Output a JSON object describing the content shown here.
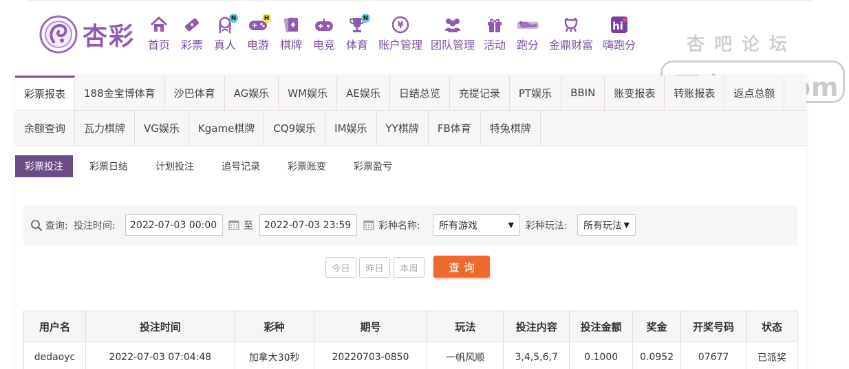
{
  "brand": {
    "name": "杏彩"
  },
  "nav": [
    {
      "label": "首页",
      "icon": "home-icon"
    },
    {
      "label": "彩票",
      "icon": "lottery-ticket-icon"
    },
    {
      "label": "真人",
      "icon": "live-dealer-icon",
      "badge": "N"
    },
    {
      "label": "电游",
      "icon": "gamepad-icon",
      "badge": "H"
    },
    {
      "label": "棋牌",
      "icon": "cards-icon"
    },
    {
      "label": "电竞",
      "icon": "esports-controller-icon"
    },
    {
      "label": "体育",
      "icon": "trophy-icon",
      "badge": "N"
    },
    {
      "label": "账户管理",
      "icon": "yen-coin-icon"
    },
    {
      "label": "团队管理",
      "icon": "team-icon"
    },
    {
      "label": "活动",
      "icon": "gift-icon"
    },
    {
      "label": "跑分",
      "icon": "running-icon"
    },
    {
      "label": "金鼎财富",
      "icon": "ding-icon"
    },
    {
      "label": "嗨跑分",
      "icon": "hi-app-icon"
    }
  ],
  "watermark": {
    "top": "杏吧论坛",
    "main": "回家14.com"
  },
  "tabs_row1": [
    "彩票报表",
    "188金宝博体育",
    "沙巴体育",
    "AG娱乐",
    "WM娱乐",
    "AE娱乐",
    "日结总览",
    "充提记录",
    "PT娱乐",
    "BBIN",
    "账变报表",
    "转账报表",
    "返点总额"
  ],
  "tabs_row2": [
    "余额查询",
    "瓦力棋牌",
    "VG娱乐",
    "Kgame棋牌",
    "CQ9娱乐",
    "IM娱乐",
    "YY棋牌",
    "FB体育",
    "特兔棋牌"
  ],
  "subtabs": [
    "彩票投注",
    "彩票日结",
    "计划投注",
    "追号记录",
    "彩票账变",
    "彩票盈亏"
  ],
  "query": {
    "label": "查询:",
    "time_label": "投注时间:",
    "start": "2022-07-03 00:00:00",
    "to": "至",
    "end": "2022-07-03 23:59:59",
    "game_label": "彩种名称:",
    "game_value": "所有游戏",
    "play_label": "彩种玩法:",
    "play_value": "所有玩法",
    "today": "今日",
    "yesterday": "昨日",
    "week": "本周",
    "search": "查询"
  },
  "table": {
    "headers": [
      "用户名",
      "投注时间",
      "彩种",
      "期号",
      "玩法",
      "投注内容",
      "投注金额",
      "奖金",
      "开奖号码",
      "状态"
    ],
    "rows": [
      [
        "dedaoyc",
        "2022-07-03 07:04:48",
        "加拿大30秒",
        "20220703-0850",
        "一帆风顺",
        "3,4,5,6,7",
        "0.1000",
        "0.0952",
        "07677",
        "已派奖"
      ]
    ]
  },
  "colors": {
    "brand_purple": "#7b4d99",
    "accent_orange": "#ee6a2c",
    "status_paid": "#e7731d"
  }
}
